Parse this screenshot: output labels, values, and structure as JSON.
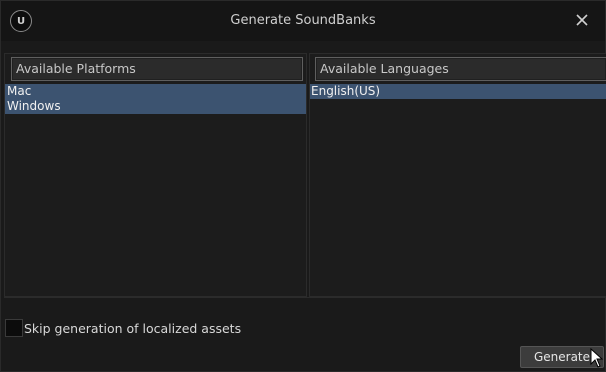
{
  "window": {
    "title": "Generate SoundBanks",
    "logo_glyph": "U",
    "close_icon": "close-icon"
  },
  "platforms": {
    "header": "Available Platforms",
    "items": [
      "Mac",
      "Windows"
    ]
  },
  "languages": {
    "header": "Available Languages",
    "items": [
      "English(US)"
    ]
  },
  "options": {
    "skip_localized_label": "Skip generation of localized assets",
    "skip_localized_checked": false
  },
  "actions": {
    "generate_label": "Generate"
  },
  "colors": {
    "selection": "#3c5370",
    "background": "#1a1a1a"
  }
}
